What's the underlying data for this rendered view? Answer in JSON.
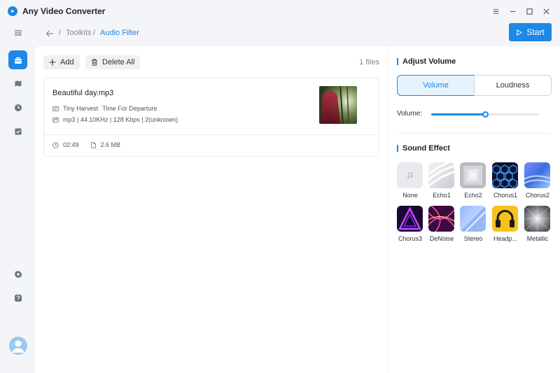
{
  "app": {
    "title": "Any Video Converter"
  },
  "breadcrumb": {
    "parent": "Toolkits",
    "separator": "/",
    "current": "Audio Filter"
  },
  "toolbar": {
    "start_label": "Start",
    "add_label": "Add",
    "delete_all_label": "Delete All",
    "file_count": "1 files"
  },
  "file": {
    "name": "Beautiful day.mp3",
    "artist": "Tiny Harvest",
    "album": "Time For Departure",
    "format_info": "mp3 | 44.10KHz | 128 Kbps | 2(unknown)",
    "duration": "02:49",
    "size": "2.6 MB"
  },
  "adjust_volume": {
    "title": "Adjust Volume",
    "tabs": [
      {
        "label": "Volume",
        "active": true
      },
      {
        "label": "Loudness",
        "active": false
      }
    ],
    "volume_label": "Volume:",
    "volume_level": 0.5
  },
  "sound_effect": {
    "title": "Sound Effect",
    "items": [
      {
        "label": "None"
      },
      {
        "label": "Echo1"
      },
      {
        "label": "Echo2"
      },
      {
        "label": "Chorus1"
      },
      {
        "label": "Chorus2"
      },
      {
        "label": "Chorus3"
      },
      {
        "label": "DeNoise"
      },
      {
        "label": "Stereo"
      },
      {
        "label": "Headp..."
      },
      {
        "label": "Metallic"
      }
    ]
  },
  "colors": {
    "accent": "#1e88e5"
  }
}
